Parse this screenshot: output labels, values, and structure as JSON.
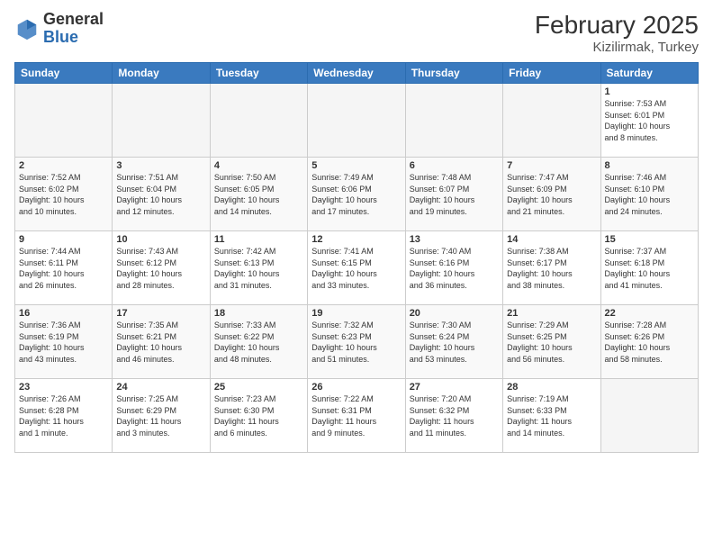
{
  "header": {
    "logo_general": "General",
    "logo_blue": "Blue",
    "month_year": "February 2025",
    "location": "Kizilirmak, Turkey"
  },
  "weekdays": [
    "Sunday",
    "Monday",
    "Tuesday",
    "Wednesday",
    "Thursday",
    "Friday",
    "Saturday"
  ],
  "weeks": [
    [
      {
        "day": "",
        "info": ""
      },
      {
        "day": "",
        "info": ""
      },
      {
        "day": "",
        "info": ""
      },
      {
        "day": "",
        "info": ""
      },
      {
        "day": "",
        "info": ""
      },
      {
        "day": "",
        "info": ""
      },
      {
        "day": "1",
        "info": "Sunrise: 7:53 AM\nSunset: 6:01 PM\nDaylight: 10 hours\nand 8 minutes."
      }
    ],
    [
      {
        "day": "2",
        "info": "Sunrise: 7:52 AM\nSunset: 6:02 PM\nDaylight: 10 hours\nand 10 minutes."
      },
      {
        "day": "3",
        "info": "Sunrise: 7:51 AM\nSunset: 6:04 PM\nDaylight: 10 hours\nand 12 minutes."
      },
      {
        "day": "4",
        "info": "Sunrise: 7:50 AM\nSunset: 6:05 PM\nDaylight: 10 hours\nand 14 minutes."
      },
      {
        "day": "5",
        "info": "Sunrise: 7:49 AM\nSunset: 6:06 PM\nDaylight: 10 hours\nand 17 minutes."
      },
      {
        "day": "6",
        "info": "Sunrise: 7:48 AM\nSunset: 6:07 PM\nDaylight: 10 hours\nand 19 minutes."
      },
      {
        "day": "7",
        "info": "Sunrise: 7:47 AM\nSunset: 6:09 PM\nDaylight: 10 hours\nand 21 minutes."
      },
      {
        "day": "8",
        "info": "Sunrise: 7:46 AM\nSunset: 6:10 PM\nDaylight: 10 hours\nand 24 minutes."
      }
    ],
    [
      {
        "day": "9",
        "info": "Sunrise: 7:44 AM\nSunset: 6:11 PM\nDaylight: 10 hours\nand 26 minutes."
      },
      {
        "day": "10",
        "info": "Sunrise: 7:43 AM\nSunset: 6:12 PM\nDaylight: 10 hours\nand 28 minutes."
      },
      {
        "day": "11",
        "info": "Sunrise: 7:42 AM\nSunset: 6:13 PM\nDaylight: 10 hours\nand 31 minutes."
      },
      {
        "day": "12",
        "info": "Sunrise: 7:41 AM\nSunset: 6:15 PM\nDaylight: 10 hours\nand 33 minutes."
      },
      {
        "day": "13",
        "info": "Sunrise: 7:40 AM\nSunset: 6:16 PM\nDaylight: 10 hours\nand 36 minutes."
      },
      {
        "day": "14",
        "info": "Sunrise: 7:38 AM\nSunset: 6:17 PM\nDaylight: 10 hours\nand 38 minutes."
      },
      {
        "day": "15",
        "info": "Sunrise: 7:37 AM\nSunset: 6:18 PM\nDaylight: 10 hours\nand 41 minutes."
      }
    ],
    [
      {
        "day": "16",
        "info": "Sunrise: 7:36 AM\nSunset: 6:19 PM\nDaylight: 10 hours\nand 43 minutes."
      },
      {
        "day": "17",
        "info": "Sunrise: 7:35 AM\nSunset: 6:21 PM\nDaylight: 10 hours\nand 46 minutes."
      },
      {
        "day": "18",
        "info": "Sunrise: 7:33 AM\nSunset: 6:22 PM\nDaylight: 10 hours\nand 48 minutes."
      },
      {
        "day": "19",
        "info": "Sunrise: 7:32 AM\nSunset: 6:23 PM\nDaylight: 10 hours\nand 51 minutes."
      },
      {
        "day": "20",
        "info": "Sunrise: 7:30 AM\nSunset: 6:24 PM\nDaylight: 10 hours\nand 53 minutes."
      },
      {
        "day": "21",
        "info": "Sunrise: 7:29 AM\nSunset: 6:25 PM\nDaylight: 10 hours\nand 56 minutes."
      },
      {
        "day": "22",
        "info": "Sunrise: 7:28 AM\nSunset: 6:26 PM\nDaylight: 10 hours\nand 58 minutes."
      }
    ],
    [
      {
        "day": "23",
        "info": "Sunrise: 7:26 AM\nSunset: 6:28 PM\nDaylight: 11 hours\nand 1 minute."
      },
      {
        "day": "24",
        "info": "Sunrise: 7:25 AM\nSunset: 6:29 PM\nDaylight: 11 hours\nand 3 minutes."
      },
      {
        "day": "25",
        "info": "Sunrise: 7:23 AM\nSunset: 6:30 PM\nDaylight: 11 hours\nand 6 minutes."
      },
      {
        "day": "26",
        "info": "Sunrise: 7:22 AM\nSunset: 6:31 PM\nDaylight: 11 hours\nand 9 minutes."
      },
      {
        "day": "27",
        "info": "Sunrise: 7:20 AM\nSunset: 6:32 PM\nDaylight: 11 hours\nand 11 minutes."
      },
      {
        "day": "28",
        "info": "Sunrise: 7:19 AM\nSunset: 6:33 PM\nDaylight: 11 hours\nand 14 minutes."
      },
      {
        "day": "",
        "info": ""
      }
    ]
  ]
}
